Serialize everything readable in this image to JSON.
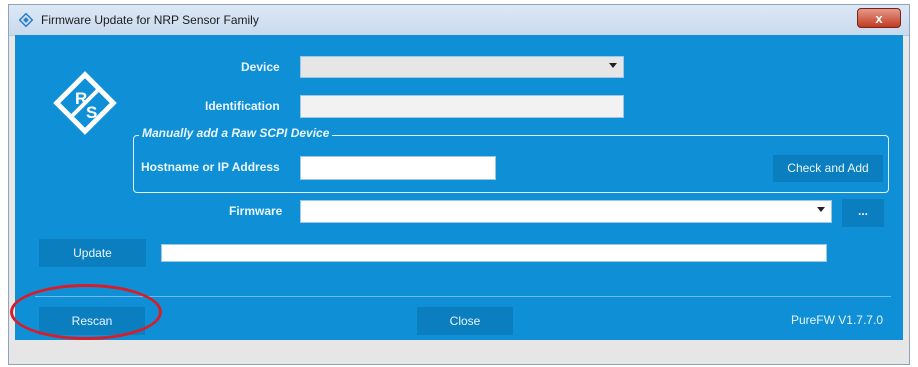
{
  "window": {
    "title": "Firmware Update for NRP Sensor Family",
    "close_label": "x"
  },
  "form": {
    "device_label": "Device",
    "identification_label": "Identification",
    "group_title": "Manually add a Raw SCPI Device",
    "hostname_label": "Hostname or IP Address",
    "check_add_label": "Check and Add",
    "firmware_label": "Firmware",
    "browse_label": "...",
    "update_label": "Update",
    "progress": 0
  },
  "footer": {
    "rescan_label": "Rescan",
    "close_label": "Close",
    "version": "PureFW  V1.7.7.0"
  },
  "icons": {
    "title_icon": "rs-diamond-icon",
    "logo": "rs-logo-icon"
  },
  "colors": {
    "background": "#0f8fd6",
    "button": "#0b7ec0",
    "annotation": "#d61e2a"
  }
}
